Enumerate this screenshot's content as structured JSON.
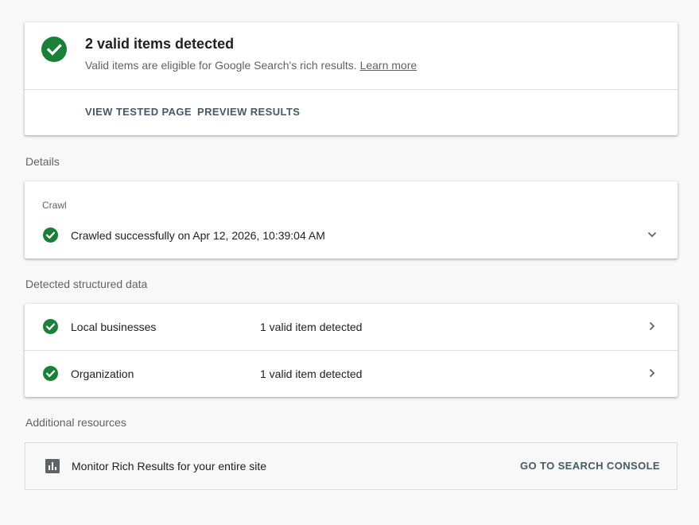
{
  "summary": {
    "title": "2 valid items detected",
    "subtitle": "Valid items are eligible for Google Search's rich results.",
    "learn_more": "Learn more",
    "actions": [
      "VIEW TESTED PAGE",
      "PREVIEW RESULTS"
    ]
  },
  "details": {
    "section_label": "Details",
    "crawl_label": "Crawl",
    "crawl_status": "Crawled successfully on Apr 12, 2026, 10:39:04 AM"
  },
  "structured_data": {
    "section_label": "Detected structured data",
    "items": [
      {
        "name": "Local businesses",
        "status": "1 valid item detected"
      },
      {
        "name": "Organization",
        "status": "1 valid item detected"
      }
    ]
  },
  "resources": {
    "section_label": "Additional resources",
    "text": "Monitor Rich Results for your entire site",
    "button": "GO TO SEARCH CONSOLE"
  },
  "icons": {
    "valid": "check-circle-icon",
    "expand": "chevron-down-icon",
    "open": "chevron-right-icon",
    "resource": "bar-chart-icon"
  },
  "colors": {
    "valid_green": "#188038",
    "action_text": "#455a64",
    "page_background": "#f8f8f8"
  }
}
